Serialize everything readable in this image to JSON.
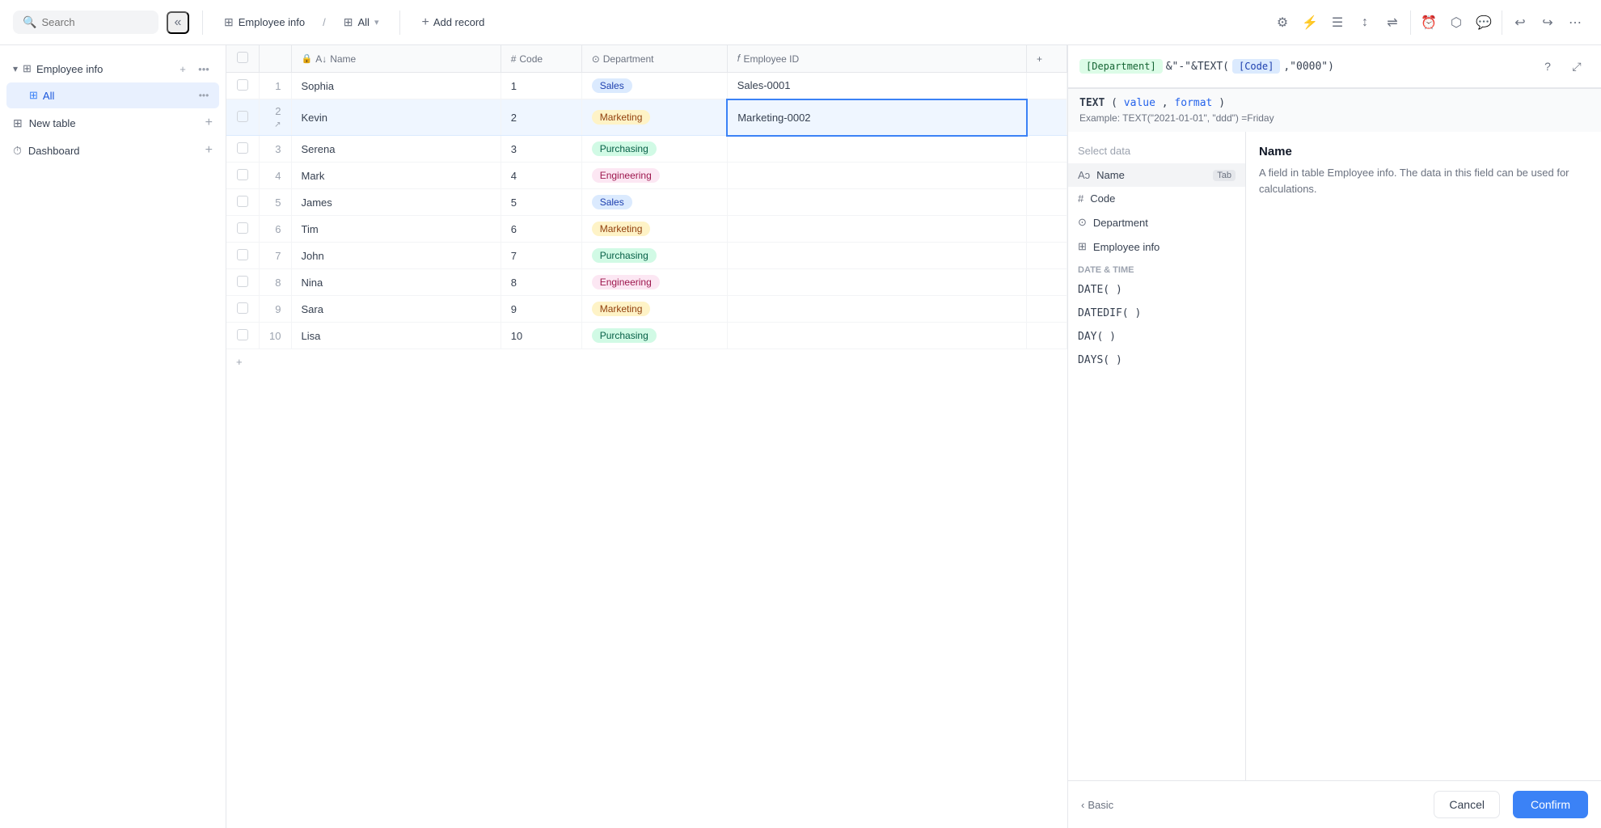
{
  "topbar": {
    "search_placeholder": "Search",
    "table_icon": "⊞",
    "table_name": "Employee info",
    "view_icon": "⊞",
    "view_name": "All",
    "add_record_label": "Add record",
    "toolbar_icons": [
      "⚙",
      "⚡",
      "☰",
      "↕",
      "⇌",
      "⏰",
      "⬡",
      "💬",
      "↩",
      "↪",
      "⋯"
    ]
  },
  "sidebar": {
    "employee_info_label": "Employee info",
    "all_label": "All",
    "new_table_label": "New table",
    "dashboard_label": "Dashboard"
  },
  "table": {
    "headers": [
      "",
      "",
      "Name",
      "Code",
      "Department",
      "Employee ID",
      ""
    ],
    "rows": [
      {
        "num": 1,
        "name": "Sophia",
        "code": 1,
        "dept": "Sales",
        "dept_class": "badge-sales",
        "emp_id": "Sales-0001"
      },
      {
        "num": 2,
        "name": "Kevin",
        "code": 2,
        "dept": "Marketing",
        "dept_class": "badge-marketing",
        "emp_id": "Marketing-0002",
        "selected": true
      },
      {
        "num": 3,
        "name": "Serena",
        "code": 3,
        "dept": "Purchasing",
        "dept_class": "badge-purchasing",
        "emp_id": ""
      },
      {
        "num": 4,
        "name": "Mark",
        "code": 4,
        "dept": "Engineering",
        "dept_class": "badge-engineering",
        "emp_id": ""
      },
      {
        "num": 5,
        "name": "James",
        "code": 5,
        "dept": "Sales",
        "dept_class": "badge-sales",
        "emp_id": ""
      },
      {
        "num": 6,
        "name": "Tim",
        "code": 6,
        "dept": "Marketing",
        "dept_class": "badge-marketing",
        "emp_id": ""
      },
      {
        "num": 7,
        "name": "John",
        "code": 7,
        "dept": "Purchasing",
        "dept_class": "badge-purchasing",
        "emp_id": ""
      },
      {
        "num": 8,
        "name": "Nina",
        "code": 8,
        "dept": "Engineering",
        "dept_class": "badge-engineering",
        "emp_id": ""
      },
      {
        "num": 9,
        "name": "Sara",
        "code": 9,
        "dept": "Marketing",
        "dept_class": "badge-marketing",
        "emp_id": ""
      },
      {
        "num": 10,
        "name": "Lisa",
        "code": 10,
        "dept": "Purchasing",
        "dept_class": "badge-purchasing",
        "emp_id": ""
      }
    ],
    "add_row_label": "+"
  },
  "formula": {
    "chip_dept": "[Department]",
    "op_text": "&\"-\"&TEXT(",
    "chip_code": "[Code]",
    "op_text2": ",\"0000\")",
    "hint_sig": "TEXT(value, format)",
    "hint_example": "Example: TEXT(\"2021-01-01\", \"ddd\") =Friday"
  },
  "dropdown": {
    "search_label": "Select data",
    "items": [
      {
        "icon": "Aↄ",
        "label": "Name",
        "badge": "Tab",
        "active": true
      },
      {
        "icon": "#",
        "label": "Code",
        "badge": ""
      },
      {
        "icon": "⊙",
        "label": "Department",
        "badge": ""
      },
      {
        "icon": "⊞",
        "label": "Employee info",
        "badge": ""
      }
    ],
    "section_datetime": "Date & Time",
    "func_items": [
      "DATE( )",
      "DATEDIF( )",
      "DAY( )",
      "DAYS( )"
    ]
  },
  "detail": {
    "title": "Name",
    "desc": "A field in table Employee info. The data in this field can be used for calculations."
  },
  "bottom": {
    "back_label": "Basic",
    "cancel_label": "Cancel",
    "confirm_label": "Confirm"
  }
}
